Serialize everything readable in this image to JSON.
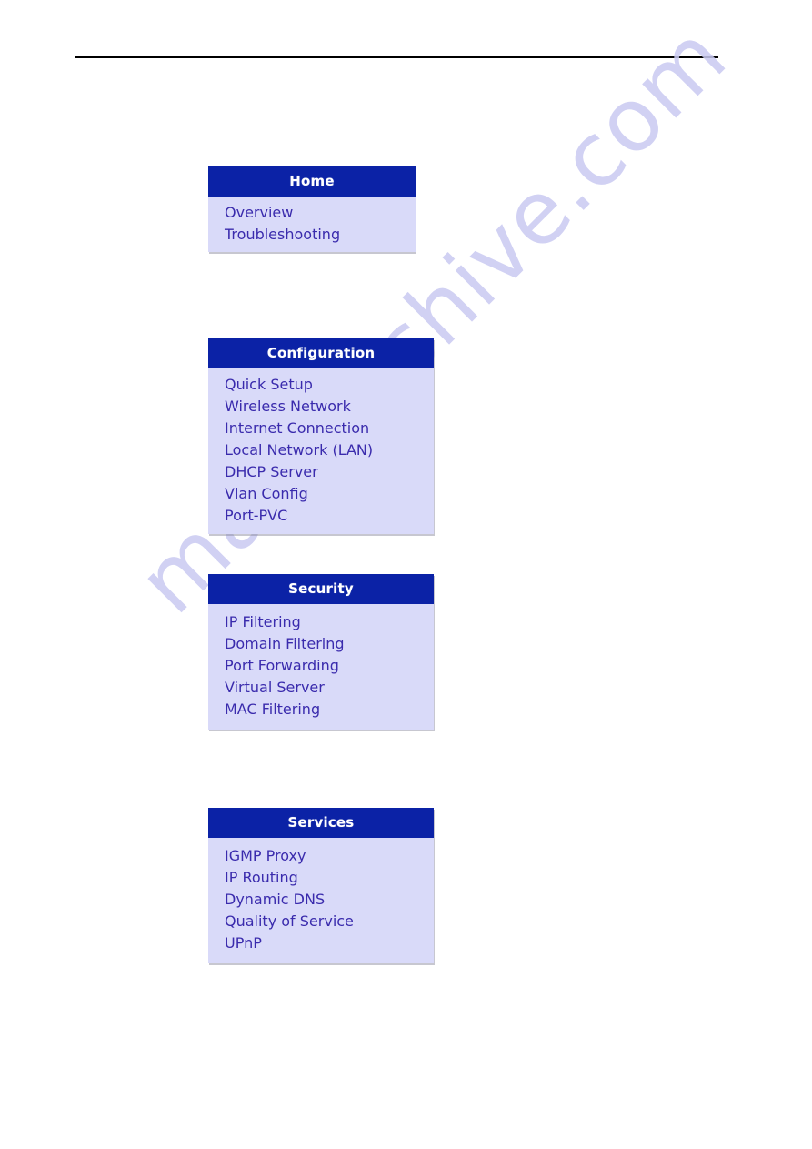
{
  "page": {
    "background_color": "#ffffff",
    "rule_color": "#000000"
  },
  "watermark": {
    "text": "manualshive.com",
    "color": "#c9caf2"
  },
  "colors": {
    "header_blue": "#0b22a6",
    "body_lavender": "#d9daf9",
    "link_indigo": "#3a2bad",
    "header_text": "#ffffff"
  },
  "menus": [
    {
      "title": "Home",
      "items": [
        "Overview",
        "Troubleshooting"
      ]
    },
    {
      "title": "Configuration",
      "items": [
        "Quick Setup",
        "Wireless Network",
        "Internet Connection",
        "Local Network (LAN)",
        "DHCP Server",
        "Vlan Config",
        "Port-PVC"
      ]
    },
    {
      "title": "Security",
      "items": [
        "IP Filtering",
        "Domain Filtering",
        "Port Forwarding",
        "Virtual Server",
        "MAC Filtering"
      ]
    },
    {
      "title": "Services",
      "items": [
        "IGMP Proxy",
        "IP Routing",
        "Dynamic DNS",
        "Quality of Service",
        "UPnP"
      ]
    }
  ]
}
